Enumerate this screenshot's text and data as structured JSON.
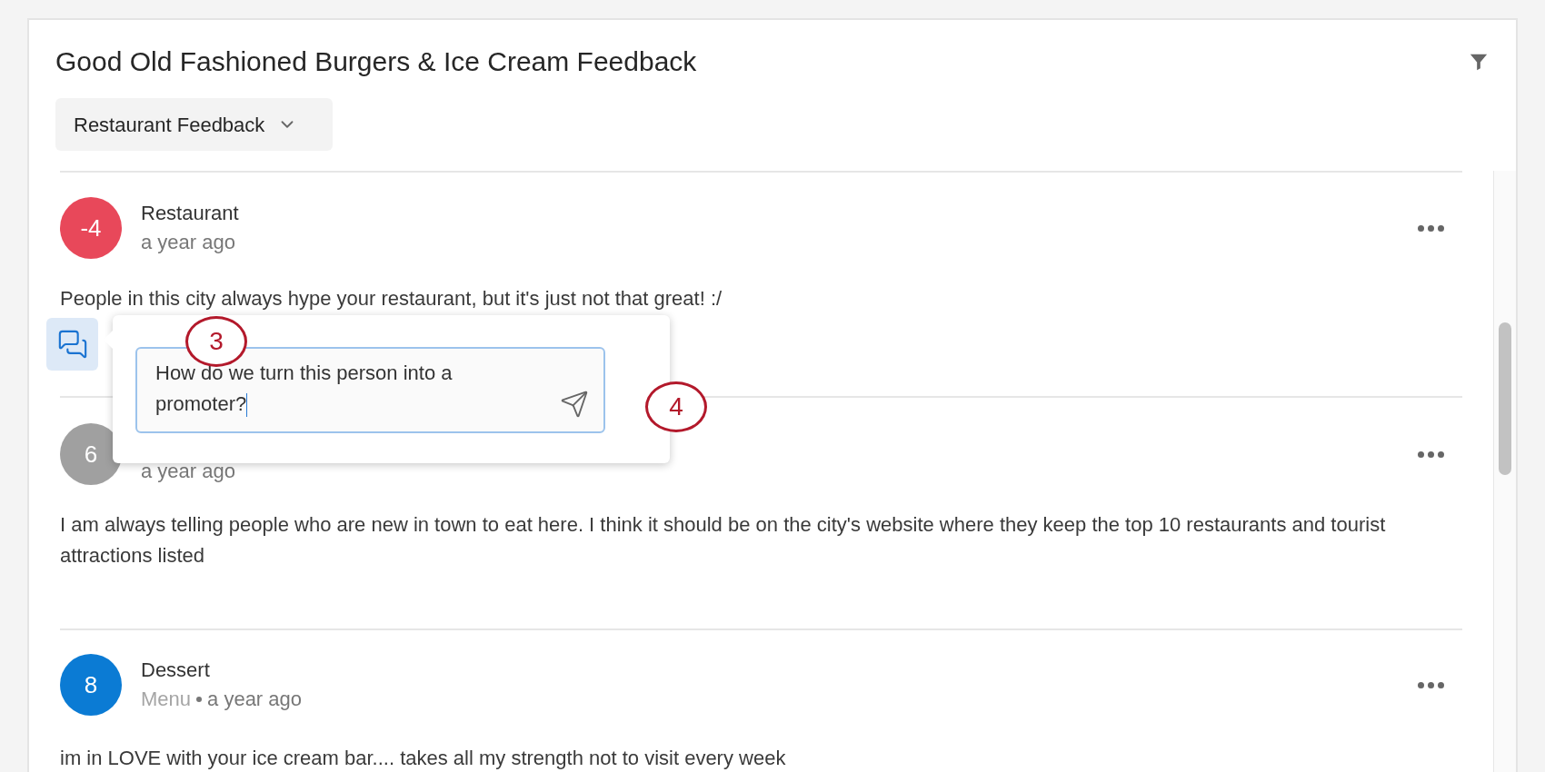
{
  "header": {
    "title": "Good Old Fashioned Burgers & Ice Cream Feedback",
    "dropdown": "Restaurant Feedback"
  },
  "responses": [
    {
      "score": "-4",
      "color": "#e8485a",
      "title": "Restaurant",
      "time": "a year ago",
      "text": "People in this city always hype your restaurant, but it's just not that great! :/",
      "comment_open": true
    },
    {
      "score": "6",
      "color": "#a0a0a0",
      "time": "a year ago",
      "text": "I am always telling people who are new in town to eat here. I think it should be on the city's website where they keep the top 10 restaurants and tourist attractions listed",
      "comment_open": false
    },
    {
      "score": "8",
      "color": "#0b7bd4",
      "title": "Dessert",
      "category": "Menu",
      "time": "a year ago",
      "text": "im in LOVE with your ice cream bar.... takes all my strength not to visit every week",
      "comment_open": false
    }
  ],
  "comment_popup": {
    "value": "How do we turn this person into a promoter?"
  },
  "annotations": [
    {
      "label": "3"
    },
    {
      "label": "4"
    }
  ]
}
